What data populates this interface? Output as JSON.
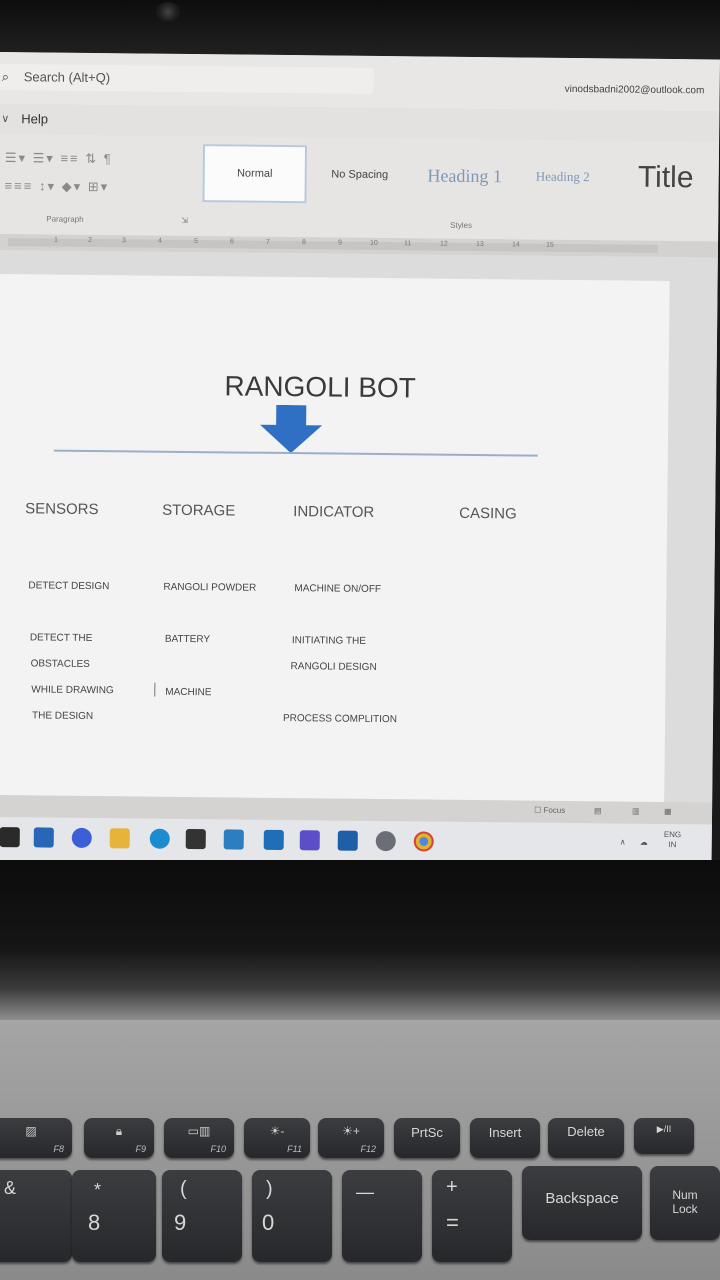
{
  "titlebar": {
    "search_text": "Search (Alt+Q)",
    "account_email": "vinodsbadni2002@outlook.com"
  },
  "menu": {
    "help": "Help"
  },
  "ribbon": {
    "paragraph_label": "Paragraph",
    "styles_label": "Styles",
    "styles": [
      "Normal",
      "No Spacing",
      "Heading 1",
      "Heading 2",
      "Title"
    ],
    "selected_style": "Normal"
  },
  "ruler": {
    "ticks": [
      "1",
      "2",
      "3",
      "4",
      "5",
      "6",
      "7",
      "8",
      "9",
      "10",
      "11",
      "12",
      "13",
      "14",
      "15"
    ]
  },
  "document": {
    "title": "RANGOLI BOT",
    "columns": [
      "SENSORS",
      "STORAGE",
      "INDICATOR",
      "CASING"
    ],
    "sensors": [
      "DETECT DESIGN",
      "DETECT THE",
      "OBSTACLES",
      "WHILE DRAWING",
      "THE DESIGN"
    ],
    "storage": [
      "RANGOLI POWDER",
      "BATTERY",
      "MACHINE"
    ],
    "indicator": [
      "MACHINE ON/OFF",
      "INITIATING THE",
      "RANGOLI DESIGN",
      "PROCESS COMPLITION"
    ],
    "arrow_color": "#2f6fc4"
  },
  "statusbar": {
    "focus": "Focus"
  },
  "tray": {
    "lang_top": "ENG",
    "lang_bottom": "IN"
  },
  "keyboard": {
    "f8": "F8",
    "f9": "F9",
    "f10": "F10",
    "f11": "F11",
    "f12": "F12",
    "prtsc": "PrtSc",
    "insert": "Insert",
    "delete": "Delete",
    "playpause": "▶/II",
    "star": "*",
    "eight": "8",
    "paren_open": "(",
    "nine": "9",
    "paren_close": ")",
    "zero": "0",
    "minus_under": "—",
    "plus": "+",
    "equals": "=",
    "backspace": "Backspace",
    "numlock_1": "Num",
    "numlock_2": "Lock",
    "amp": "&"
  }
}
